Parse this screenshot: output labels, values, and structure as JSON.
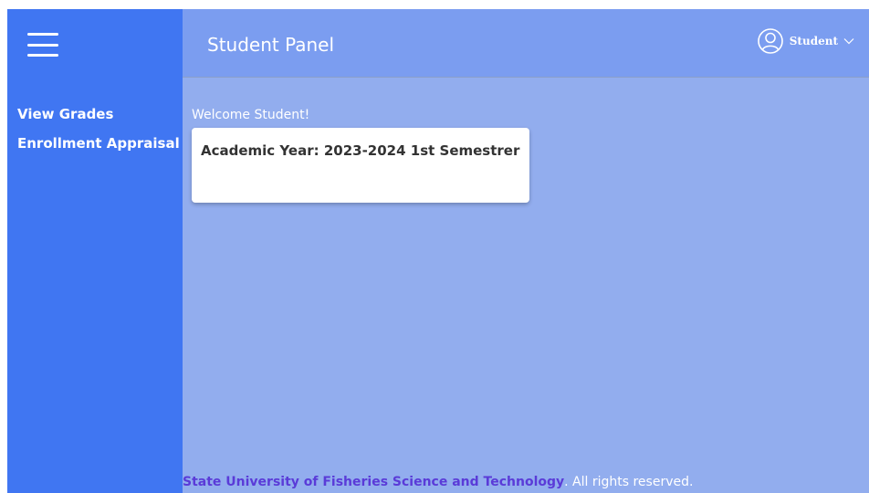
{
  "sidebar": {
    "menu_icon": "hamburger-icon",
    "items": [
      {
        "label": "View Grades"
      },
      {
        "label": "Enrollment Appraisal"
      }
    ]
  },
  "header": {
    "title": "Student Panel",
    "user": {
      "icon": "user-circle-icon",
      "name": "Student",
      "dropdown_icon": "chevron-down-icon"
    }
  },
  "main": {
    "welcome": "Welcome Student!",
    "card": {
      "title": "Academic Year: 2023-2024 1st Semestrer"
    }
  },
  "footer": {
    "org": "State University of Fisheries Science and Technology",
    "rights": ". All rights reserved."
  },
  "colors": {
    "sidebar": "#4076f2",
    "topbar": "#7b9df0",
    "main": "#92adee",
    "footer_link": "#5a3bd8"
  }
}
